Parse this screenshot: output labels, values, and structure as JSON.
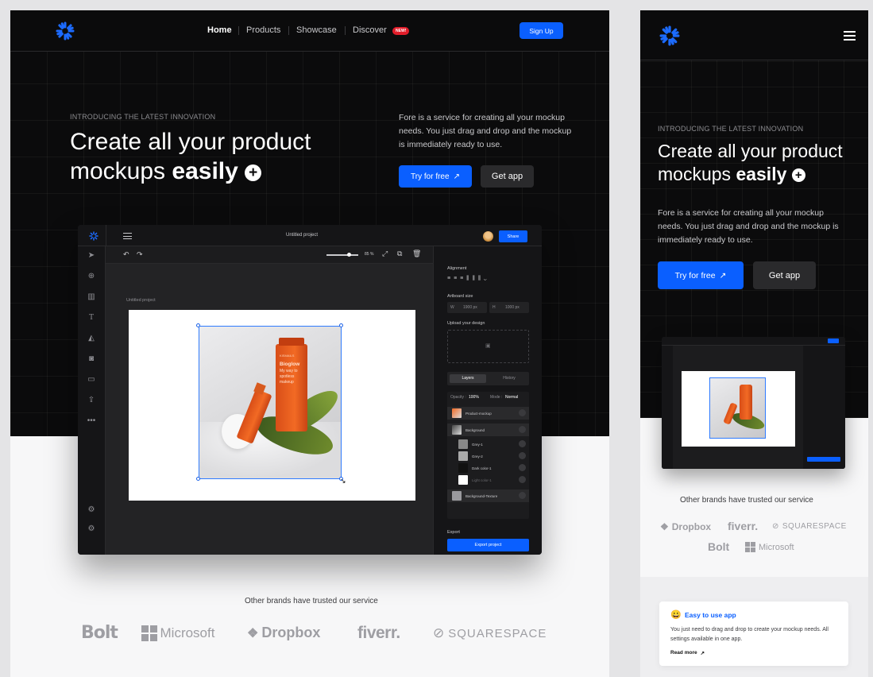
{
  "desktop": {
    "nav": {
      "links": [
        "Home",
        "Products",
        "Showcase",
        "Discover"
      ],
      "badge": "NEW!",
      "signup": "Sign Up"
    },
    "hero": {
      "eyebrow": "INTRODUCING THE LATEST INNOVATION",
      "headline_line1": "Create all your product",
      "headline_line2_pre": "mockups ",
      "headline_line2_bold": "easily",
      "description": "Fore is a service for creating all your mockup needs. You just drag and drop and the mockup is immediately ready to use.",
      "cta_primary": "Try for free",
      "cta_secondary": "Get app"
    },
    "editor": {
      "title": "Untitled project",
      "share": "Share",
      "zoom": "85 %",
      "canvas_label": "Untitled project",
      "alignment": "Alignment",
      "artboard_size": "Artboard size",
      "width_label": "W",
      "width_value": "1900 px",
      "height_label": "H",
      "height_value": "1000 px",
      "upload": "Upload your design",
      "tabs": [
        "Layers",
        "History"
      ],
      "opacity_label": "Opacity :",
      "opacity_value": "100%",
      "mode_label": "Mode :",
      "mode_value": "Normal",
      "layers": [
        "Product-mockup",
        "Background",
        "Grey-1",
        "Grey-2",
        "Dark color-1",
        "Light color-1",
        "Background-Texture"
      ],
      "export_label": "Export",
      "export_button": "Export project",
      "product_text_1": "Bioglow",
      "product_text_2": "My way to",
      "product_text_3": "spotless",
      "product_text_4": "makeup",
      "product_brand": "KISMAILS"
    },
    "brands": {
      "title": "Other brands have trusted our service",
      "items": [
        "Bolt",
        "Microsoft",
        "Dropbox",
        "fiverr.",
        "SQUARESPACE"
      ]
    }
  },
  "mobile": {
    "hero": {
      "eyebrow": "INTRODUCING THE LATEST INNOVATION",
      "headline_line1": "Create all your product",
      "headline_line2_pre": "mockups ",
      "headline_line2_bold": "easily",
      "description": "Fore is a service for creating all your mockup needs. You just drag and drop and the mockup is immediately ready to use.",
      "cta_primary": "Try for free",
      "cta_secondary": "Get app"
    },
    "brands": {
      "title": "Other brands have trusted our service",
      "items": [
        "Dropbox",
        "fiverr.",
        "SQUARESPACE",
        "Bolt",
        "Microsoft"
      ]
    },
    "feature": {
      "emoji": "😀",
      "title": "Easy to use app",
      "description": "You just need to drag and drop to create your mockup needs. All settings available in one app.",
      "link": "Read more"
    }
  },
  "colors": {
    "accent": "#0a5fff",
    "hero_bg": "#0b0b0c",
    "badge": "#e11d2a",
    "product_orange": "#f26a24"
  }
}
